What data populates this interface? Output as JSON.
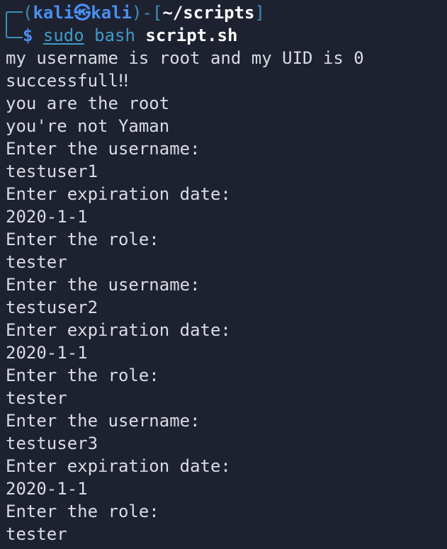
{
  "prompt": {
    "user": "kali",
    "at_symbol": "㉿",
    "host": "kali",
    "path": "~/scripts",
    "dollar": "$",
    "command": "sudo",
    "command2": "bash",
    "argument": "script.sh"
  },
  "output": [
    "my username is root and my UID is 0",
    "successfull‼",
    "you are the root",
    "you're not Yaman",
    "Enter the username:",
    "testuser1",
    "Enter expiration date:",
    "2020-1-1",
    "Enter the role:",
    "tester",
    "Enter the username:",
    "testuser2",
    "Enter expiration date:",
    "2020-1-1",
    "Enter the role:",
    "tester",
    "Enter the username:",
    "testuser3",
    "Enter expiration date:",
    "2020-1-1",
    "Enter the role:",
    "tester"
  ]
}
